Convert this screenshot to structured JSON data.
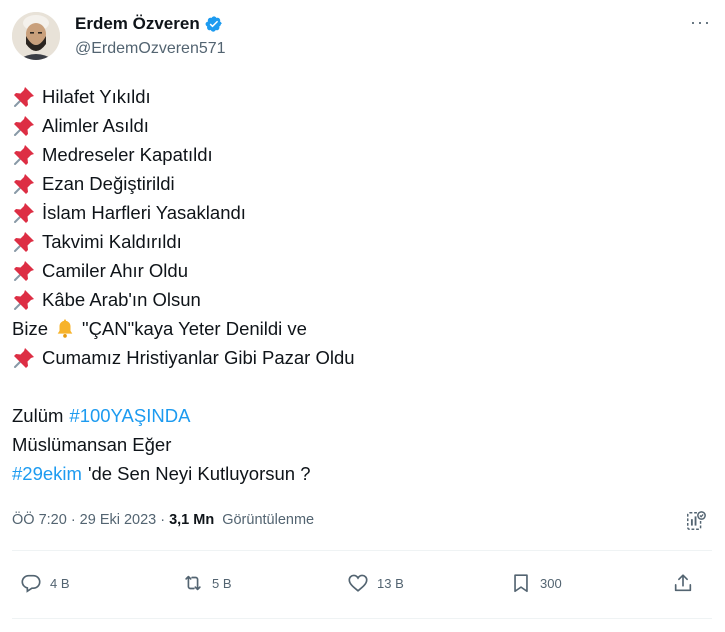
{
  "user": {
    "display_name": "Erdem Özveren",
    "handle": "@ErdemOzveren571",
    "verified": true,
    "avatar_icon": "avatar-portrait"
  },
  "more_icon": "more-icon",
  "tweet": {
    "lines": [
      {
        "icon": "pushpin",
        "text": "Hilafet Yıkıldı"
      },
      {
        "icon": "pushpin",
        "text": "Alimler Asıldı"
      },
      {
        "icon": "pushpin",
        "text": "Medreseler Kapatıldı"
      },
      {
        "icon": "pushpin",
        "text": "Ezan Değiştirildi"
      },
      {
        "icon": "pushpin",
        "text": "İslam Harfleri Yasaklandı"
      },
      {
        "icon": "pushpin",
        "text": "Takvimi Kaldırıldı"
      },
      {
        "icon": "pushpin",
        "text": "Camiler Ahır Oldu"
      },
      {
        "icon": "pushpin",
        "text": "Kâbe Arab'ın Olsun"
      }
    ],
    "bell_line": {
      "before": "Bize",
      "after": "\"ÇAN\"kaya Yeter Denildi ve"
    },
    "last_pin_line": "Cumamız Hristiyanlar Gibi Pazar Oldu",
    "zulum_text": "Zulüm",
    "hashtag_1": "#100YAŞINDA",
    "muslim_line": "Müslümansan Eğer",
    "hashtag_2": "#29ekim",
    "final_text": "'de Sen Neyi Kutluyorsun ?"
  },
  "meta": {
    "time": "ÖÖ 7:20",
    "dot": "·",
    "date": "29 Eki 2023",
    "dot2": "·",
    "views": "3,1 Mn",
    "views_label": "Görüntülenme"
  },
  "actions": {
    "reply_count": "4 B",
    "retweet_count": "5 B",
    "like_count": "13 B",
    "bookmark_count": "300"
  },
  "colors": {
    "accent": "#1d9bf0",
    "secondary_text": "#536471",
    "pin_red": "#dd2e44"
  }
}
